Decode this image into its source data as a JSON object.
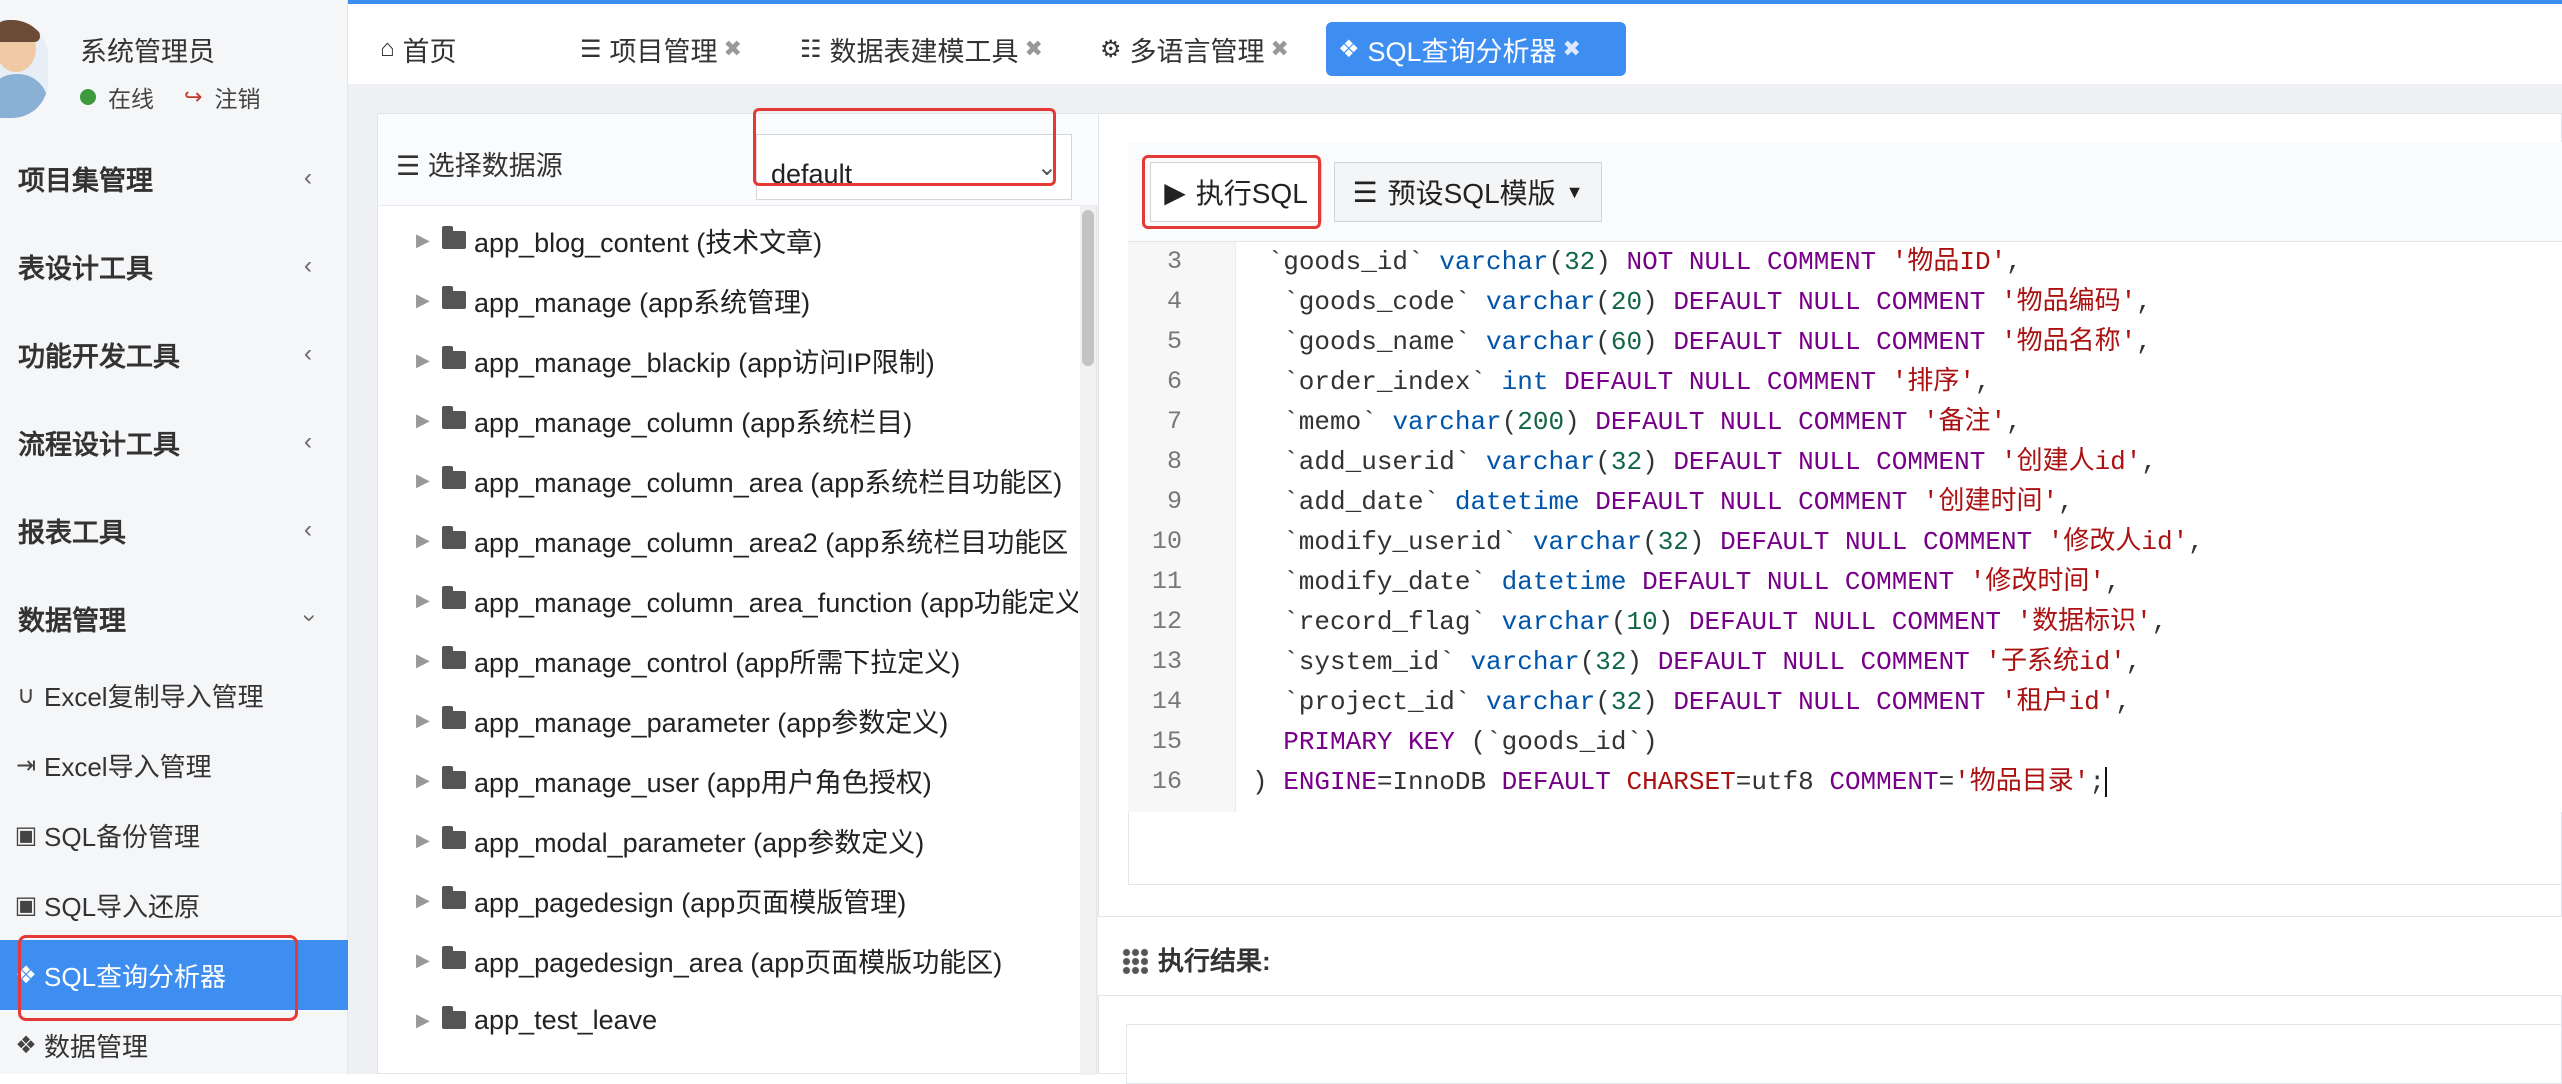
{
  "user": {
    "name": "系统管理员",
    "status": "在线",
    "logout": "注销"
  },
  "sidebar": {
    "groups": [
      {
        "label": "项目集管理"
      },
      {
        "label": "表设计工具"
      },
      {
        "label": "功能开发工具"
      },
      {
        "label": "流程设计工具"
      },
      {
        "label": "报表工具"
      },
      {
        "label": "数据管理"
      }
    ],
    "items": [
      {
        "label": "Excel复制导入管理",
        "icon": "magnet-icon"
      },
      {
        "label": "Excel导入管理",
        "icon": "sign-in-icon"
      },
      {
        "label": "SQL备份管理",
        "icon": "database-backup-icon"
      },
      {
        "label": "SQL导入还原",
        "icon": "database-restore-icon"
      },
      {
        "label": "SQL查询分析器",
        "icon": "cubes-icon",
        "active": true
      },
      {
        "label": "数据管理",
        "icon": "cubes-icon"
      }
    ]
  },
  "tabs": [
    {
      "label": "首页",
      "icon": "home-icon"
    },
    {
      "label": "项目管理",
      "icon": "server-icon"
    },
    {
      "label": "数据表建模工具",
      "icon": "grid-icon"
    },
    {
      "label": "多语言管理",
      "icon": "gear-icon"
    },
    {
      "label": "SQL查询分析器",
      "icon": "cubes-icon",
      "active": true
    }
  ],
  "datasource": {
    "label": "选择数据源",
    "selected": "default"
  },
  "tables": [
    "app_blog_content (技术文章)",
    "app_manage (app系统管理)",
    "app_manage_blackip (app访问IP限制)",
    "app_manage_column (app系统栏目)",
    "app_manage_column_area (app系统栏目功能区)",
    "app_manage_column_area2 (app系统栏目功能区",
    "app_manage_column_area_function (app功能定义",
    "app_manage_control (app所需下拉定义)",
    "app_manage_parameter (app参数定义)",
    "app_manage_user (app用户角色授权)",
    "app_modal_parameter (app参数定义)",
    "app_pagedesign (app页面模版管理)",
    "app_pagedesign_area (app页面模版功能区)",
    "app_test_leave"
  ],
  "toolbar": {
    "exec_label": "执行SQL",
    "template_label": "预设SQL模版"
  },
  "code": {
    "line_numbers": [
      "3",
      "4",
      "5",
      "6",
      "7",
      "8",
      "9",
      "10",
      "11",
      "12",
      "13",
      "14",
      "15",
      "16"
    ]
  },
  "results": {
    "title": "执行结果:"
  },
  "colors": {
    "accent": "#3d8ef0",
    "highlight": "#e53935"
  }
}
